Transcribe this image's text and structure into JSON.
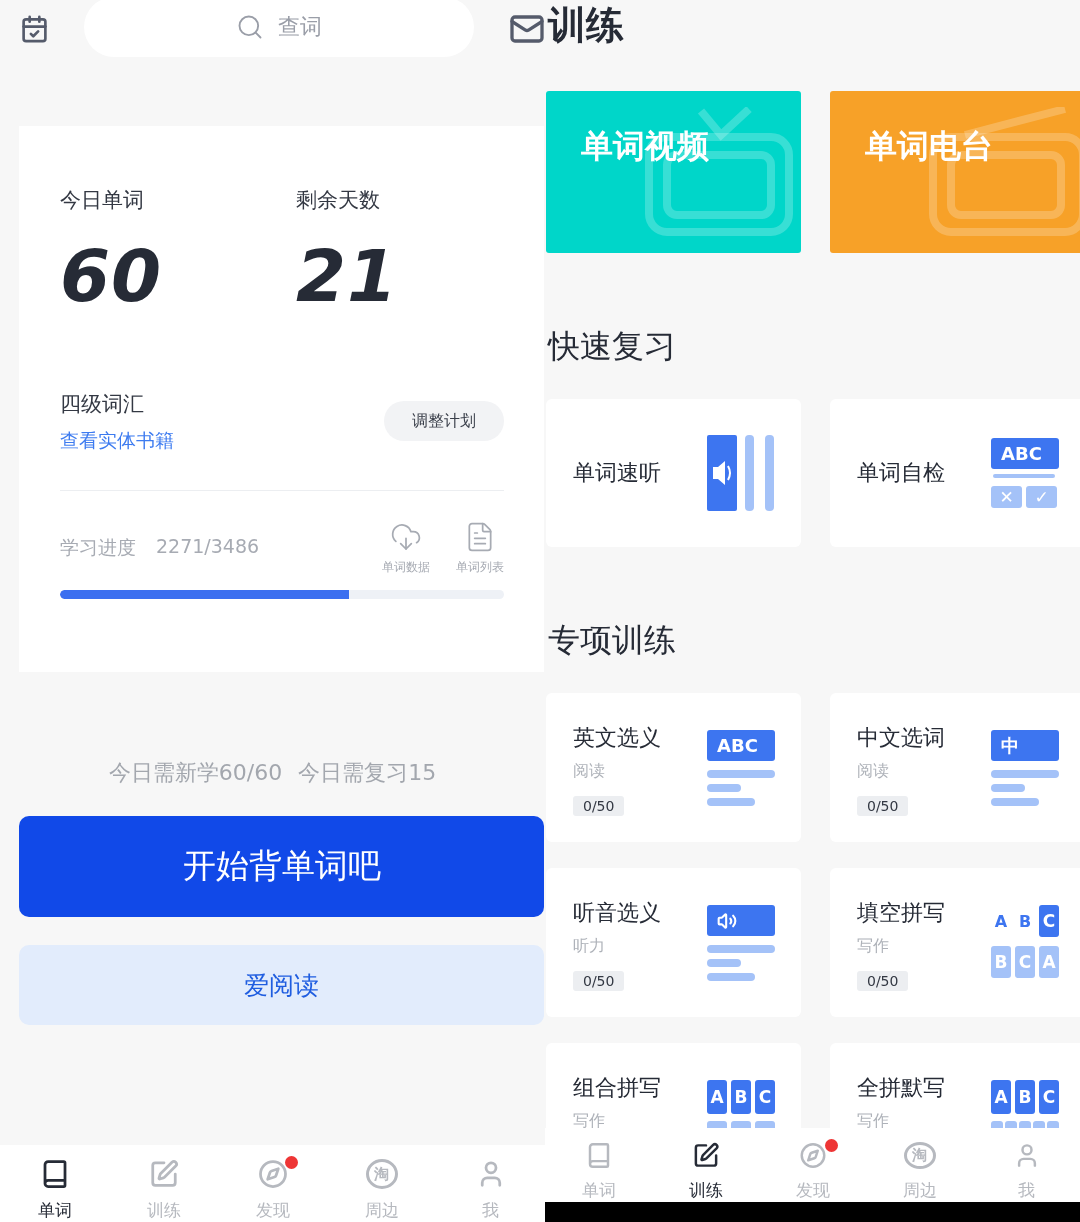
{
  "left": {
    "search": {
      "placeholder": "查词"
    },
    "plan": {
      "stats": [
        {
          "label": "今日单词",
          "value": "60"
        },
        {
          "label": "剩余天数",
          "value": "21"
        }
      ],
      "book": "四级词汇",
      "book_link": "查看实体书籍",
      "adjust_button": "调整计划",
      "progress": {
        "label": "学习进度",
        "count": "2271/3486",
        "level": 0.65,
        "actions": [
          {
            "kind": "cloud",
            "label": "单词数据"
          },
          {
            "kind": "list",
            "label": "单词列表"
          }
        ]
      }
    },
    "summary": [
      "今日需新学60/60",
      "今日需复习15"
    ],
    "start_button": "开始背单词吧",
    "read_button": "爱阅读",
    "tabs": [
      {
        "label": "单词",
        "kind": "book",
        "selected": true,
        "badge": false
      },
      {
        "label": "训练",
        "kind": "pen",
        "selected": false,
        "badge": false
      },
      {
        "label": "发现",
        "kind": "compass",
        "selected": false,
        "badge": true
      },
      {
        "label": "周边",
        "kind": "glyph",
        "glyph": "淘",
        "selected": false,
        "badge": false
      },
      {
        "label": "我",
        "kind": "user",
        "selected": false,
        "badge": false
      }
    ]
  },
  "right": {
    "title": "训练",
    "banners": [
      {
        "kind": "tv",
        "label": "单词视频",
        "color": "#00d6c9"
      },
      {
        "kind": "fm",
        "label": "单词电台",
        "color": "#f7a128"
      }
    ],
    "quick_title": "快速复习",
    "quick": [
      {
        "label": "单词速听",
        "art": {
          "kind": "speaker"
        }
      },
      {
        "label": "单词自检",
        "art": {
          "kind": "check",
          "label": "ABC",
          "marks": [
            "✕",
            "✓"
          ]
        }
      }
    ],
    "special_title": "专项训练",
    "cards": [
      {
        "title": "英文选义",
        "category": "阅读",
        "progress": "0/50",
        "art": {
          "kind": "label-lines",
          "label": "ABC"
        }
      },
      {
        "title": "中文选词",
        "category": "阅读",
        "progress": "0/50",
        "art": {
          "kind": "label-lines",
          "label": "中"
        }
      },
      {
        "title": "听音选义",
        "category": "听力",
        "progress": "0/50",
        "art": {
          "kind": "speaker-lines"
        }
      },
      {
        "title": "填空拼写",
        "category": "写作",
        "progress": "0/50",
        "art": {
          "kind": "fill-blank",
          "top": [
            {
              "letter": "A",
              "boxed": false
            },
            {
              "letter": "B",
              "boxed": false
            },
            {
              "letter": "C",
              "boxed": true
            }
          ],
          "bottom": [
            "B",
            "C",
            "A"
          ]
        }
      },
      {
        "title": "组合拼写",
        "category": "写作",
        "art": {
          "kind": "combine",
          "letters": [
            "A",
            "B",
            "C"
          ]
        }
      },
      {
        "title": "全拼默写",
        "category": "写作",
        "art": {
          "kind": "dictation",
          "letters": [
            "A",
            "B",
            "C"
          ]
        }
      }
    ],
    "tabs": [
      {
        "label": "单词",
        "kind": "book",
        "selected": false,
        "badge": false
      },
      {
        "label": "训练",
        "kind": "pen",
        "selected": true,
        "badge": false
      },
      {
        "label": "发现",
        "kind": "compass",
        "selected": false,
        "badge": true
      },
      {
        "label": "周边",
        "kind": "glyph",
        "glyph": "淘",
        "selected": false,
        "badge": false
      },
      {
        "label": "我",
        "kind": "user",
        "selected": false,
        "badge": false
      }
    ]
  }
}
